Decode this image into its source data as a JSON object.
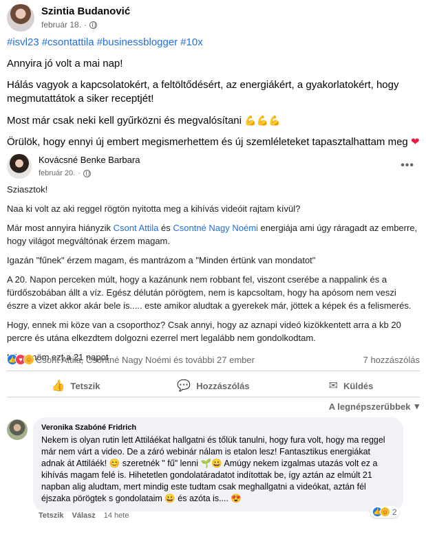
{
  "post": {
    "author": "Szintia Budanović",
    "date": "február 18.",
    "hashtags": [
      "#isvl23",
      "#csontattila",
      "#businessblogger",
      "#10x"
    ],
    "paragraphs": [
      "Annyira jó volt a mai nap!",
      "Hálás vagyok a kapcsolatokért, a feltöltődésért, az energiákért, a gyakorlatokért, hogy megmutattátok a siker receptjét!",
      "Most már csak neki kell gyűrközni és megvalósítani",
      "Örülök, hogy ennyi új embert megismerhettem és új szemléleteket tapasztalhattam meg"
    ],
    "muscle_emojis": "💪💪💪",
    "heart_emoji": "❤"
  },
  "shared": {
    "author": "Kovácsné Benke Barbara",
    "date": "február 20.",
    "more": "•••",
    "greeting": "Sziasztok!",
    "p1": "Naa ki volt az aki reggel rögtön nyitotta meg a kihívás videóit rajtam kívül?",
    "p2_before": "Már most annyira hiányzik ",
    "mention1": "Csont Attila",
    "p2_mid": " és ",
    "mention2": "Csontné Nagy Noémi",
    "p2_after": " energiája ami úgy ráragadt az emberre, hogy világot megváltónak érzem magam.",
    "p3": "Igazán \"fűnek\" érzem magam, és mantrázom a \"Minden értünk van mondatot\"",
    "p4": "A 20. Napon perceken múlt, hogy a kazánunk nem robbant fel, viszont cserébe a nappalink és a fürdőszobában állt a víz. Egész délután pörögtem, nem is kapcsoltam, hogy ha apósom nem veszi észre a vizet akkor akár bele is..... este amikor aludtak a gyerekek már, jöttek a képek és a felismerés.",
    "p5": "Hogy, ennek mi köze van a csoporthoz? Csak annyi, hogy az aznapi videó kizökkentett arra a kb 20 percre és utána elkezdtem dolgozni ezerrel mert legalább nem gondolkodtam.",
    "p6": "Köszönöm ezt a 21 napot"
  },
  "reactions": {
    "icons": [
      "like",
      "love",
      "care"
    ],
    "text": "Csont Attila, Csontné Nagy Noémi és további 27 ember",
    "comments": "7 hozzászólás"
  },
  "actions": {
    "like": "Tetszik",
    "comment": "Hozzászólás",
    "send": "Küldés"
  },
  "sort": {
    "label": "A legnépszerűbbek"
  },
  "comment": {
    "author": "Veronika Szabóné Fridrich",
    "text": "Nekem is olyan rutin lett Attiláékat hallgatni és tőlük tanulni, hogy fura volt, hogy ma reggel már nem várt a video. De a záró webinár nálam is etalon lesz! Fantasztikus energiákat adnak át Attiláék! 😊 szeretnék \" fű\" lenni 🌱😀 Amúgy nekem izgalmas utazás volt ez a kihívás magam felé is. Hihetetlen gondolatáradatot indítottak be, így aztán az elmúlt 21 napban alig aludtam, mert mindig este tudtam csak meghallgatni a videókat, aztán fél éjszaka pörögtek s gondolataim 😀 és azóta is.... 😍",
    "like": "Tetszik",
    "reply": "Válasz",
    "time": "14 hete",
    "react_count": "2"
  },
  "colors": {
    "link": "#216fdb",
    "muted": "#65676b",
    "like": "#1877f2",
    "love": "#f33e58",
    "bubble": "#f0f2f5"
  }
}
